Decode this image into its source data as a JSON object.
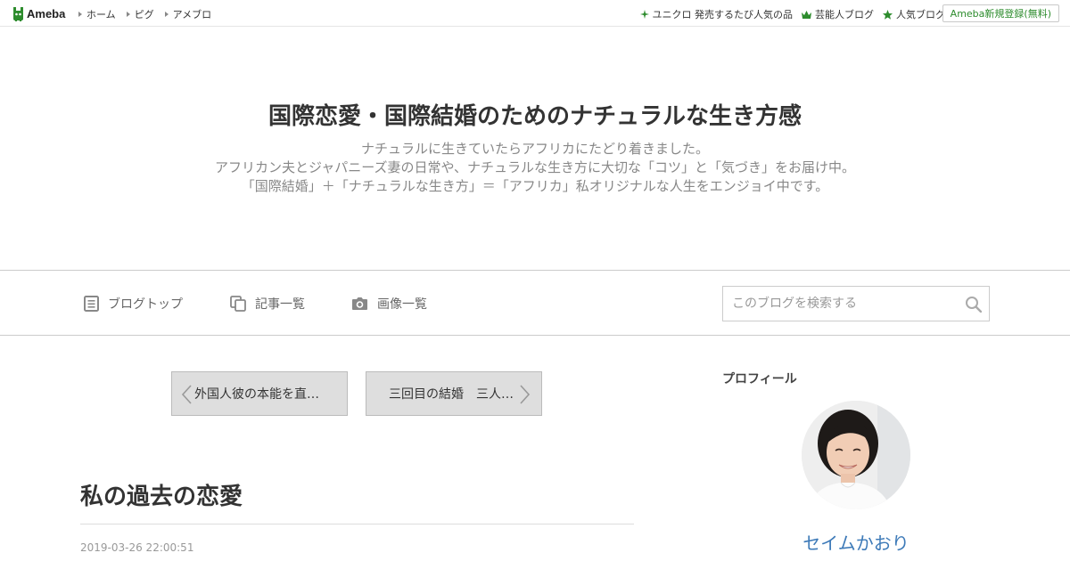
{
  "topbar": {
    "logo_text": "Ameba",
    "nav": [
      "ホーム",
      "ピグ",
      "アメブロ"
    ],
    "right_links": [
      {
        "label": "ユニクロ 発売するたび人気の品",
        "icon": "sparkle-icon"
      },
      {
        "label": "芸能人ブログ",
        "icon": "crown-icon"
      },
      {
        "label": "人気ブログ",
        "icon": "star-icon"
      }
    ],
    "signup_label": "Ameba新規登録(無料)"
  },
  "header": {
    "title": "国際恋愛・国際結婚のためのナチュラルな生き方感",
    "description": [
      "ナチュラルに生きていたらアフリカにたどり着きました。",
      "アフリカン夫とジャパニーズ妻の日常や、ナチュラルな生き方に大切な「コツ」と「気づき」をお届け中。",
      "「国際結婚」＋「ナチュラルな生き方」＝「アフリカ」私オリジナルな人生をエンジョイ中です。"
    ]
  },
  "blognav": {
    "items": [
      {
        "label": "ブログトップ",
        "icon": "document-icon"
      },
      {
        "label": "記事一覧",
        "icon": "copy-icon"
      },
      {
        "label": "画像一覧",
        "icon": "camera-icon"
      }
    ],
    "search_placeholder": "このブログを検索する"
  },
  "pager": {
    "prev_label": "外国人彼の本能を直…",
    "next_label": "三回目の結婚　三人…"
  },
  "article": {
    "title": "私の過去の恋愛",
    "date": "2019-03-26 22:00:51"
  },
  "sidebar": {
    "heading": "プロフィール",
    "name": "セイムかおり"
  },
  "colors": {
    "ameba_green": "#2d8c2d",
    "link_blue": "#3d7ab8",
    "pager_bg": "#dedede"
  }
}
